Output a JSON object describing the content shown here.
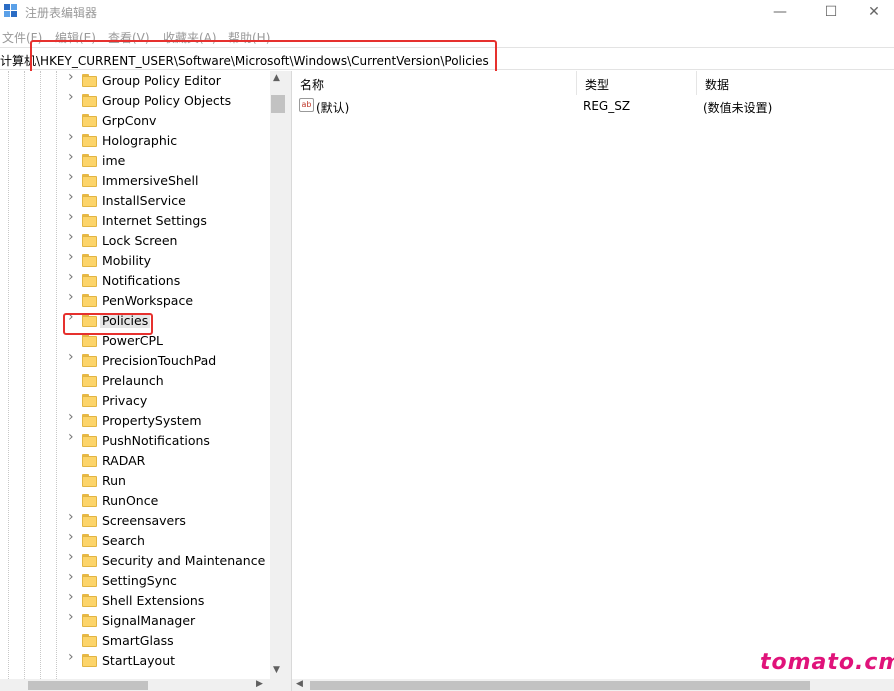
{
  "window": {
    "title": "注册表编辑器",
    "app_icon": "registry-editor-icon",
    "minimize_icon": "minimize-icon",
    "maximize_icon": "maximize-icon",
    "close_icon": "close-icon"
  },
  "menu": [
    "文件(F)",
    "编辑(E)",
    "查看(V)",
    "收藏夹(A)",
    "帮助(H)"
  ],
  "address": {
    "path": "计算机\\HKEY_CURRENT_USER\\Software\\Microsoft\\Windows\\CurrentVersion\\Policies"
  },
  "tree": {
    "items": [
      {
        "label": "Group Policy Editor",
        "expandable": true
      },
      {
        "label": "Group Policy Objects",
        "expandable": true
      },
      {
        "label": "GrpConv",
        "expandable": false
      },
      {
        "label": "Holographic",
        "expandable": true
      },
      {
        "label": "ime",
        "expandable": true
      },
      {
        "label": "ImmersiveShell",
        "expandable": true
      },
      {
        "label": "InstallService",
        "expandable": true
      },
      {
        "label": "Internet Settings",
        "expandable": true
      },
      {
        "label": "Lock Screen",
        "expandable": true
      },
      {
        "label": "Mobility",
        "expandable": true
      },
      {
        "label": "Notifications",
        "expandable": true
      },
      {
        "label": "PenWorkspace",
        "expandable": true
      },
      {
        "label": "Policies",
        "expandable": true,
        "selected": true
      },
      {
        "label": "PowerCPL",
        "expandable": false
      },
      {
        "label": "PrecisionTouchPad",
        "expandable": true
      },
      {
        "label": "Prelaunch",
        "expandable": false
      },
      {
        "label": "Privacy",
        "expandable": false
      },
      {
        "label": "PropertySystem",
        "expandable": true
      },
      {
        "label": "PushNotifications",
        "expandable": true
      },
      {
        "label": "RADAR",
        "expandable": false
      },
      {
        "label": "Run",
        "expandable": false
      },
      {
        "label": "RunOnce",
        "expandable": false
      },
      {
        "label": "Screensavers",
        "expandable": true
      },
      {
        "label": "Search",
        "expandable": true
      },
      {
        "label": "Security and Maintenance",
        "expandable": true
      },
      {
        "label": "SettingSync",
        "expandable": true
      },
      {
        "label": "Shell Extensions",
        "expandable": true
      },
      {
        "label": "SignalManager",
        "expandable": true
      },
      {
        "label": "SmartGlass",
        "expandable": false
      },
      {
        "label": "StartLayout",
        "expandable": true
      }
    ]
  },
  "list": {
    "columns": {
      "name": "名称",
      "type": "类型",
      "data": "数据"
    },
    "rows": [
      {
        "icon": "string-value-icon",
        "name": "(默认)",
        "type": "REG_SZ",
        "data": "(数值未设置)"
      }
    ]
  },
  "colors": {
    "highlight": "#e6312e",
    "watermark": "#e0137a",
    "folder": "#fcd46a"
  },
  "watermark": "tomato.cm"
}
